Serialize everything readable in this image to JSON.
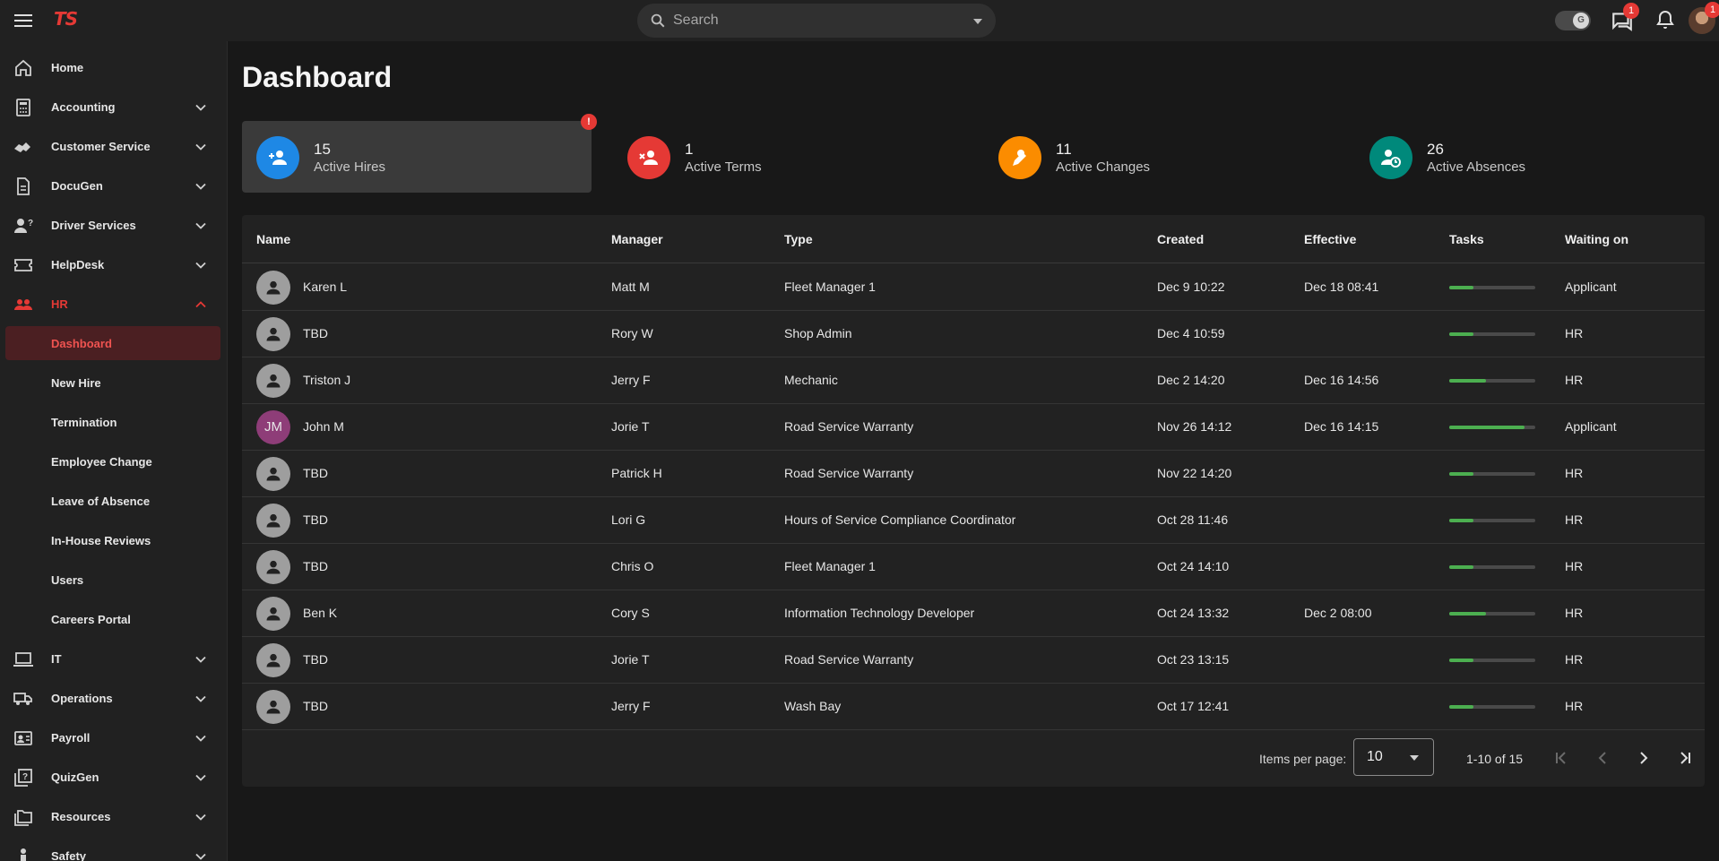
{
  "app": {
    "logo": "TS"
  },
  "search": {
    "placeholder": "Search"
  },
  "toggle": {
    "knob": "G"
  },
  "topbar": {
    "messages_badge": "1",
    "avatar_badge": "1"
  },
  "sidebar": {
    "items": [
      {
        "label": "Home",
        "icon": "home-icon"
      },
      {
        "label": "Accounting",
        "icon": "calculator-icon"
      },
      {
        "label": "Customer Service",
        "icon": "handshake-icon"
      },
      {
        "label": "DocuGen",
        "icon": "document-icon"
      },
      {
        "label": "Driver Services",
        "icon": "person-question-icon"
      },
      {
        "label": "HelpDesk",
        "icon": "ticket-icon"
      },
      {
        "label": "HR",
        "icon": "people-icon"
      },
      {
        "label": "IT",
        "icon": "laptop-icon"
      },
      {
        "label": "Operations",
        "icon": "truck-icon"
      },
      {
        "label": "Payroll",
        "icon": "badge-icon"
      },
      {
        "label": "QuizGen",
        "icon": "quiz-icon"
      },
      {
        "label": "Resources",
        "icon": "folders-icon"
      },
      {
        "label": "Safety",
        "icon": "safety-icon"
      }
    ],
    "hr_sub": [
      "Dashboard",
      "New Hire",
      "Termination",
      "Employee Change",
      "Leave of Absence",
      "In-House Reviews",
      "Users",
      "Careers Portal"
    ]
  },
  "page": {
    "title": "Dashboard"
  },
  "stats": [
    {
      "count": "15",
      "label": "Active Hires",
      "color": "#1e88e5",
      "alert": "!"
    },
    {
      "count": "1",
      "label": "Active Terms",
      "color": "#e53935"
    },
    {
      "count": "11",
      "label": "Active Changes",
      "color": "#fb8c00"
    },
    {
      "count": "26",
      "label": "Active Absences",
      "color": "#00897b"
    }
  ],
  "table": {
    "headers": [
      "Name",
      "Manager",
      "Type",
      "Created",
      "Effective",
      "Tasks",
      "Waiting on"
    ],
    "rows": [
      {
        "initials": "",
        "name": "Karen L",
        "manager": "Matt M",
        "type": "Fleet Manager 1",
        "created": "Dec 9 10:22",
        "effective": "Dec 18 08:41",
        "progress": 0.28,
        "waiting": "Applicant"
      },
      {
        "initials": "",
        "name": "TBD",
        "manager": "Rory W",
        "type": "Shop Admin",
        "created": "Dec 4 10:59",
        "effective": "",
        "progress": 0.28,
        "waiting": "HR"
      },
      {
        "initials": "",
        "name": "Triston J",
        "manager": "Jerry F",
        "type": "Mechanic",
        "created": "Dec 2 14:20",
        "effective": "Dec 16 14:56",
        "progress": 0.43,
        "waiting": "HR"
      },
      {
        "initials": "JM",
        "name": "John M",
        "manager": "Jorie T",
        "type": "Road Service Warranty",
        "created": "Nov 26 14:12",
        "effective": "Dec 16 14:15",
        "progress": 0.88,
        "waiting": "Applicant"
      },
      {
        "initials": "",
        "name": "TBD",
        "manager": "Patrick H",
        "type": "Road Service Warranty",
        "created": "Nov 22 14:20",
        "effective": "",
        "progress": 0.28,
        "waiting": "HR"
      },
      {
        "initials": "",
        "name": "TBD",
        "manager": "Lori G",
        "type": "Hours of Service Compliance Coordinator",
        "created": "Oct 28 11:46",
        "effective": "",
        "progress": 0.28,
        "waiting": "HR"
      },
      {
        "initials": "",
        "name": "TBD",
        "manager": "Chris O",
        "type": "Fleet Manager 1",
        "created": "Oct 24 14:10",
        "effective": "",
        "progress": 0.28,
        "waiting": "HR"
      },
      {
        "initials": "",
        "name": "Ben K",
        "manager": "Cory S",
        "type": "Information Technology Developer",
        "created": "Oct 24 13:32",
        "effective": "Dec 2 08:00",
        "progress": 0.43,
        "waiting": "HR"
      },
      {
        "initials": "",
        "name": "TBD",
        "manager": "Jorie T",
        "type": "Road Service Warranty",
        "created": "Oct 23 13:15",
        "effective": "",
        "progress": 0.28,
        "waiting": "HR"
      },
      {
        "initials": "",
        "name": "TBD",
        "manager": "Jerry F",
        "type": "Wash Bay",
        "created": "Oct 17 12:41",
        "effective": "",
        "progress": 0.28,
        "waiting": "HR"
      }
    ]
  },
  "pager": {
    "items_per_page_label": "Items per page:",
    "items_per_page": "10",
    "range": "1-10 of 15"
  }
}
